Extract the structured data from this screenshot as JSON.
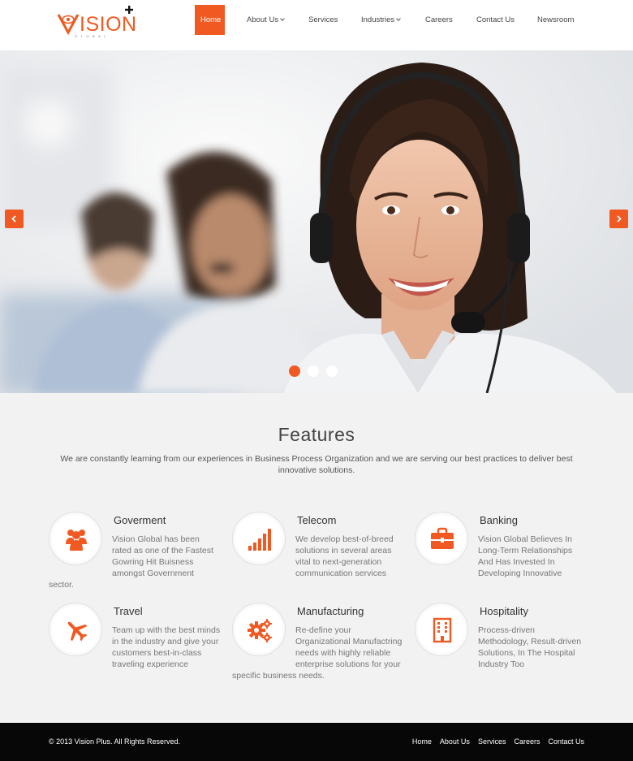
{
  "brand": {
    "name": "VISION",
    "tagline": "GLOBAL",
    "accent": "#f05a22"
  },
  "nav": [
    {
      "label": "Home",
      "active": true
    },
    {
      "label": "About Us",
      "dropdown": true
    },
    {
      "label": "Services"
    },
    {
      "label": "Industries",
      "dropdown": true
    },
    {
      "label": "Careers"
    },
    {
      "label": "Contact Us"
    },
    {
      "label": "Newsroom"
    }
  ],
  "hero": {
    "slides": 3,
    "active_slide": 1,
    "image": "call-center-agent-with-headset"
  },
  "features": {
    "title": "Features",
    "subtitle": "We are constantly learning from our experiences in Business Process Organization and we are serving our best practices to deliver best innovative solutions.",
    "items": [
      {
        "title": "Goverment",
        "text": "Vision Global has been rated as one of the Fastest Gowring Hit Buisness amongst Government sector.",
        "icon": "users-icon"
      },
      {
        "title": "Telecom",
        "text": "We develop best-of-breed solutions in several areas vital to next-generation communication services",
        "icon": "signal-bars-icon"
      },
      {
        "title": "Banking",
        "text": "Vision Global Believes In Long-Term Relationships And Has Invested In Developing Innovative",
        "icon": "briefcase-icon"
      },
      {
        "title": "Travel",
        "text": "Team up with the best minds in the industry and give your customers best-in-class traveling experience",
        "icon": "airplane-icon"
      },
      {
        "title": "Manufacturing",
        "text": "Re-define your Organizational Manufactring needs with highly reliable enterprise solutions for your specific business needs.",
        "icon": "gears-icon"
      },
      {
        "title": "Hospitality",
        "text": "Process-driven Methodology, Result-driven Solutions, In The Hospital Industry Too",
        "icon": "building-icon"
      }
    ]
  },
  "footer": {
    "copyright": "© 2013 Vision Plus. All Rights Reserved.",
    "links": [
      "Home",
      "About Us",
      "Services",
      "Careers",
      "Contact Us"
    ]
  }
}
